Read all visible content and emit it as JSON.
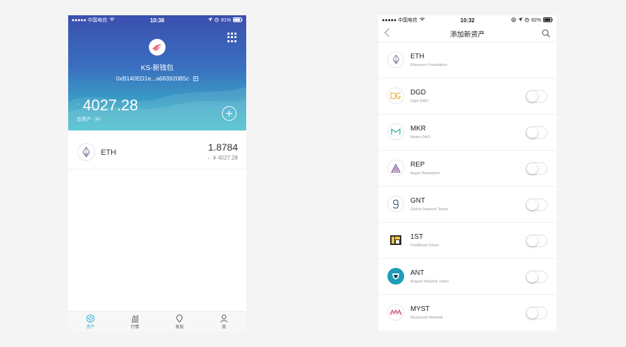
{
  "left": {
    "status": {
      "carrier": "●●●●● 中国电信",
      "time": "10:38",
      "battery": "81%"
    },
    "wallet": {
      "name": "KS-新钱包",
      "address": "0xB140ED1e...a683920B5c",
      "balance": "4027.28",
      "balance_dot": "≈",
      "balance_label": "总资产（¥）"
    },
    "assets": [
      {
        "symbol": "ETH",
        "amount": "1.8784",
        "fiat_prefix": "≈",
        "fiat": "¥ 4027.28",
        "icon": "ethereum-icon"
      }
    ],
    "nav": [
      {
        "label": "资产",
        "icon": "assets-icon",
        "active": true
      },
      {
        "label": "行情",
        "icon": "market-icon",
        "active": false
      },
      {
        "label": "发现",
        "icon": "discover-icon",
        "active": false
      },
      {
        "label": "我",
        "icon": "profile-icon",
        "active": false
      }
    ],
    "colors": {
      "accent": "#2fb1d6",
      "header_top": "#3b4fae",
      "header_bottom": "#3bbcc9"
    }
  },
  "right": {
    "status": {
      "carrier": "●●●●● 中国电信",
      "time": "10:32",
      "battery": "82%"
    },
    "title": "添加新资产",
    "tokens": [
      {
        "symbol": "ETH",
        "name": "Ethereum Foundation",
        "icon": "ethereum-icon",
        "toggle": false
      },
      {
        "symbol": "DGD",
        "name": "Digix DAO",
        "icon": "digix-icon",
        "toggle": true
      },
      {
        "symbol": "MKR",
        "name": "Maker DAO",
        "icon": "maker-icon",
        "toggle": true
      },
      {
        "symbol": "REP",
        "name": "Augur Reputation",
        "icon": "augur-icon",
        "toggle": true
      },
      {
        "symbol": "GNT",
        "name": "Golem Network Token",
        "icon": "golem-icon",
        "toggle": true
      },
      {
        "symbol": "1ST",
        "name": "FirstBlood Token",
        "icon": "firstblood-icon",
        "toggle": true
      },
      {
        "symbol": "ANT",
        "name": "Aragon Network Token",
        "icon": "aragon-icon",
        "toggle": true
      },
      {
        "symbol": "MYST",
        "name": "Mysterium Network",
        "icon": "mysterium-icon",
        "toggle": true
      }
    ]
  }
}
